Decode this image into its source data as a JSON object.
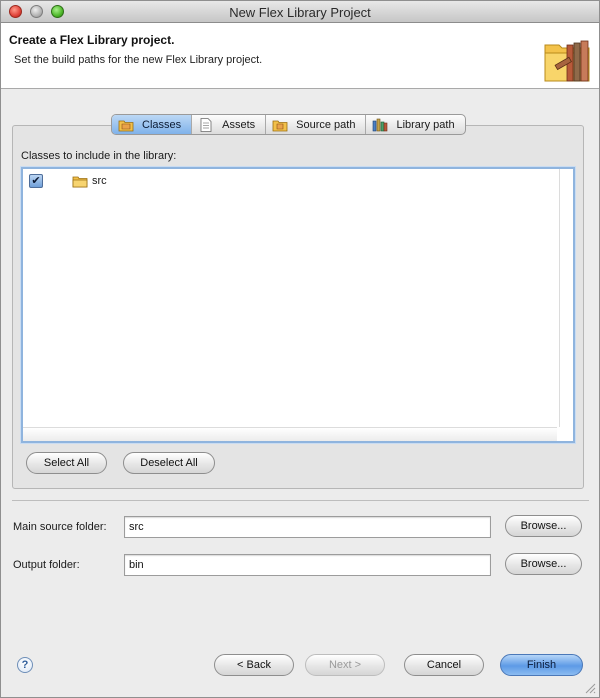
{
  "window": {
    "title": "New Flex Library Project"
  },
  "header": {
    "title": "Create a Flex Library project.",
    "subtitle": "Set the build paths for the new Flex Library project.",
    "icon": "library-books-icon"
  },
  "tabs": [
    {
      "label": "Classes",
      "icon": "package-folder-icon",
      "active": true
    },
    {
      "label": "Assets",
      "icon": "document-icon",
      "active": false
    },
    {
      "label": "Source path",
      "icon": "source-folder-icon",
      "active": false
    },
    {
      "label": "Library path",
      "icon": "library-icon",
      "active": false
    }
  ],
  "classes": {
    "label": "Classes to include in the library:",
    "tree": [
      {
        "label": "src",
        "checked": true,
        "icon": "folder-icon"
      }
    ],
    "select_all": "Select All",
    "deselect_all": "Deselect All"
  },
  "form": {
    "main_source_label": "Main source folder:",
    "main_source_value": "src",
    "output_label": "Output folder:",
    "output_value": "bin",
    "browse_label": "Browse..."
  },
  "footer": {
    "help": "?",
    "back": "< Back",
    "next": "Next >",
    "cancel": "Cancel",
    "finish": "Finish"
  },
  "colors": {
    "accent": "#6fa6e8",
    "window_bg": "#ececec"
  }
}
